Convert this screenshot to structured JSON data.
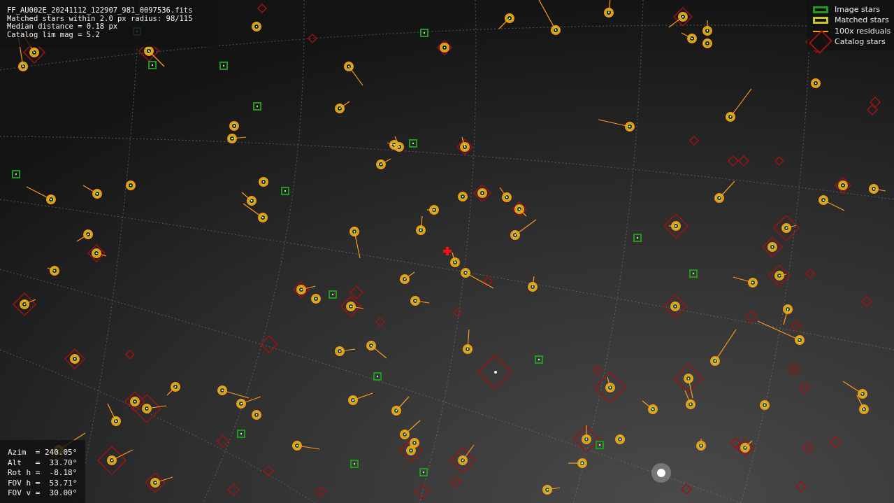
{
  "file_info": [
    "FF_AU002E_20241112_122907_981_0097536.fits",
    "Matched stars within 2.0 px radius: 98/115",
    "Median distance = 0.18 px",
    "Catalog lim mag = 5.2"
  ],
  "legend": [
    {
      "kind": "image",
      "label": "Image stars",
      "color": "#1f9a1f"
    },
    {
      "kind": "matched",
      "label": "Matched stars",
      "color": "#c8c81e"
    },
    {
      "kind": "residual",
      "label": "100x residuals",
      "color": "#ff9a1e"
    },
    {
      "kind": "catalog",
      "label": "Catalog stars",
      "color": "#9a1414"
    }
  ],
  "pointing": [
    "Azim  = 240.05°",
    "Alt   =  33.70°",
    "Rot h =  -8.18°",
    "FOV h =  53.71°",
    "FOV v =  30.00°"
  ]
}
